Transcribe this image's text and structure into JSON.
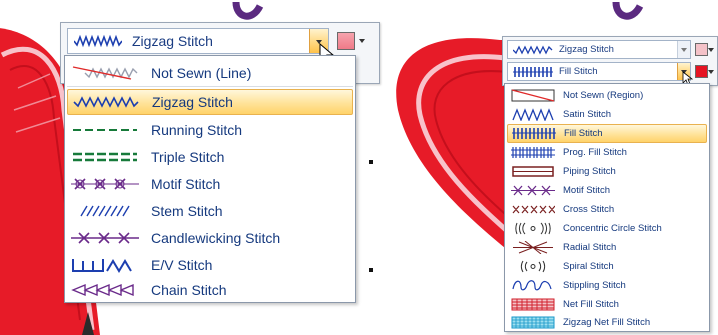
{
  "colors": {
    "highlight": "#ffd97a",
    "text": "#15397e",
    "heart_red": "#ea1c2a",
    "heart_pink": "#f7b3bd"
  },
  "left_panel": {
    "combo_label": "Zigzag Stitch",
    "items": [
      {
        "label": "Not Sewn (Line)",
        "icon": "not-sewn-line-icon"
      },
      {
        "label": "Zigzag Stitch",
        "icon": "zigzag-stitch-icon",
        "selected": true
      },
      {
        "label": "Running Stitch",
        "icon": "running-stitch-icon"
      },
      {
        "label": "Triple Stitch",
        "icon": "triple-stitch-icon"
      },
      {
        "label": "Motif Stitch",
        "icon": "motif-stitch-icon"
      },
      {
        "label": "Stem Stitch",
        "icon": "stem-stitch-icon"
      },
      {
        "label": "Candlewicking Stitch",
        "icon": "candlewicking-stitch-icon"
      },
      {
        "label": "E/V Stitch",
        "icon": "ev-stitch-icon"
      },
      {
        "label": "Chain Stitch",
        "icon": "chain-stitch-icon"
      }
    ]
  },
  "right_panel": {
    "line_combo_label": "Zigzag Stitch",
    "fill_combo_label": "Fill Stitch",
    "items": [
      {
        "label": "Not Sewn (Region)",
        "icon": "not-sewn-region-icon"
      },
      {
        "label": "Satin Stitch",
        "icon": "satin-stitch-icon"
      },
      {
        "label": "Fill Stitch",
        "icon": "fill-stitch-icon",
        "selected": true
      },
      {
        "label": "Prog. Fill Stitch",
        "icon": "prog-fill-stitch-icon"
      },
      {
        "label": "Piping Stitch",
        "icon": "piping-stitch-icon"
      },
      {
        "label": "Motif Stitch",
        "icon": "motif-stitch-icon"
      },
      {
        "label": "Cross Stitch",
        "icon": "cross-stitch-icon"
      },
      {
        "label": "Concentric Circle Stitch",
        "icon": "concentric-circle-stitch-icon"
      },
      {
        "label": "Radial Stitch",
        "icon": "radial-stitch-icon"
      },
      {
        "label": "Spiral Stitch",
        "icon": "spiral-stitch-icon"
      },
      {
        "label": "Stippling Stitch",
        "icon": "stippling-stitch-icon"
      },
      {
        "label": "Net Fill Stitch",
        "icon": "net-fill-stitch-icon"
      },
      {
        "label": "Zigzag Net Fill Stitch",
        "icon": "zigzag-net-fill-stitch-icon"
      }
    ]
  }
}
